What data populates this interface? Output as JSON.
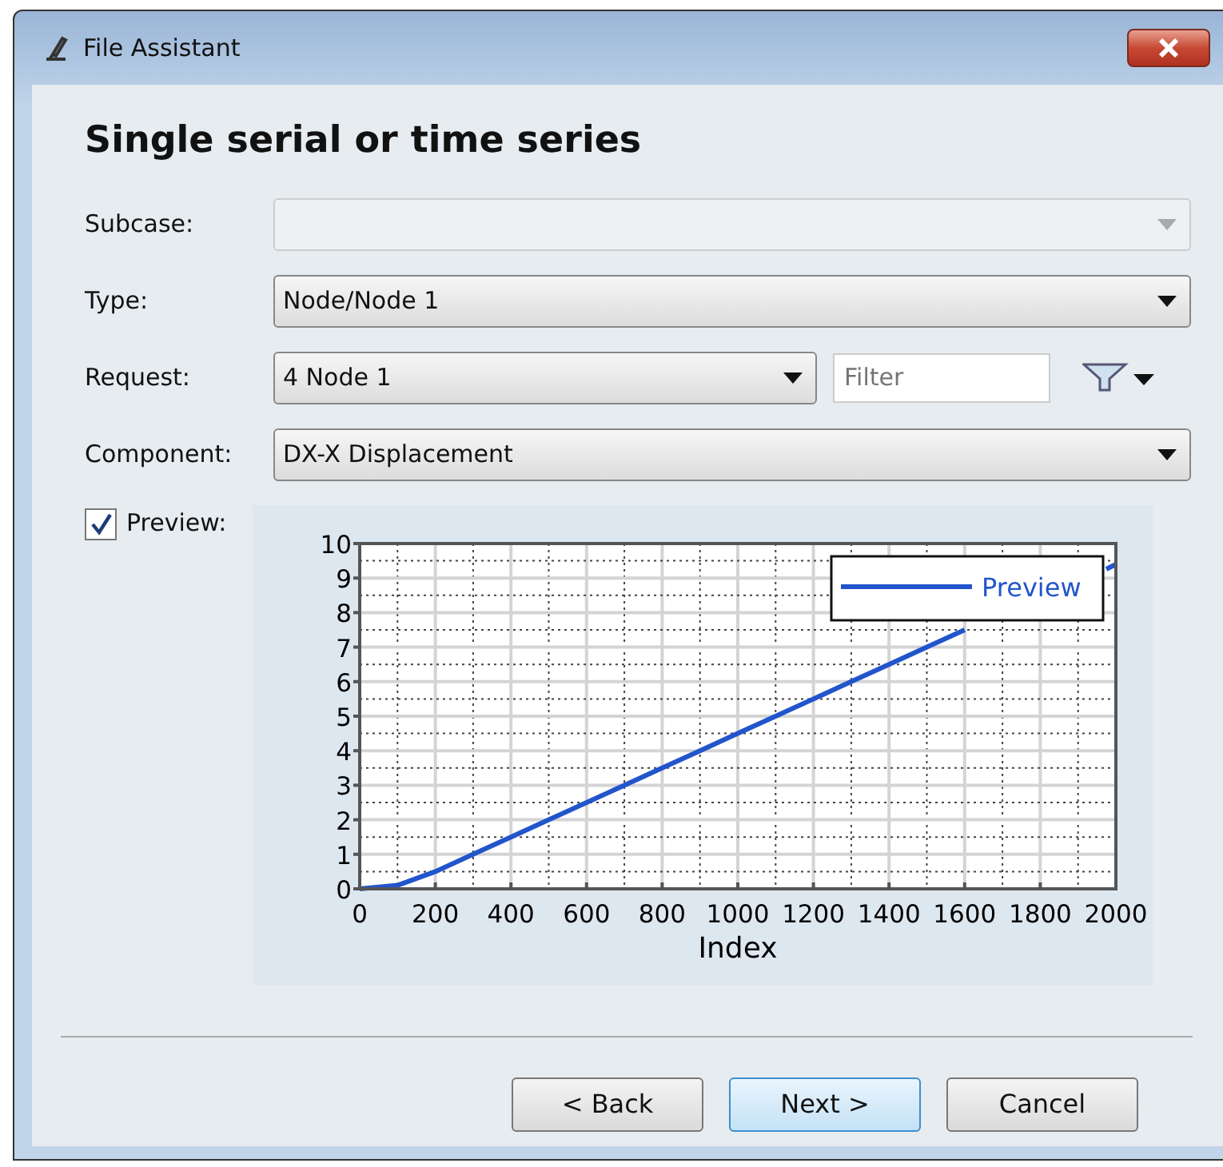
{
  "window": {
    "title": "File Assistant"
  },
  "heading": "Single serial or time series",
  "fields": [
    {
      "kind": "select",
      "label": "Subcase:",
      "disabled": true
    },
    {
      "kind": "select",
      "label": "Type:",
      "value": "Node/Node 1",
      "disabled": false
    },
    {
      "kind": "select_filter",
      "label": "Request:",
      "value": "4 Node 1",
      "disabled": false,
      "filter_placeholder": "Filter"
    },
    {
      "kind": "select",
      "label": "Component:",
      "value": "DX-X Displacement",
      "disabled": false
    }
  ],
  "preview": {
    "label": "Preview:",
    "checked": true,
    "chart_data": {
      "type": "line",
      "grid": true,
      "xlabel": "Index",
      "xlim": [
        0,
        2000
      ],
      "ylim": [
        0,
        10
      ],
      "xticks": [
        0,
        200,
        400,
        600,
        800,
        1000,
        1200,
        1400,
        1600,
        1800,
        2000
      ],
      "yticks": [
        0,
        1,
        2,
        3,
        4,
        5,
        6,
        7,
        8,
        9,
        10
      ],
      "x": [
        0,
        100,
        200,
        300,
        400,
        500,
        600,
        700,
        800,
        900,
        1000,
        1100,
        1200,
        1300,
        1400,
        1500,
        1600,
        1700,
        1800,
        1900,
        2000
      ],
      "series": [
        {
          "name": "Preview",
          "color": "#2255cc",
          "values": [
            0,
            0.1,
            0.5,
            1.0,
            1.5,
            2.0,
            2.5,
            3.0,
            3.5,
            4.0,
            4.5,
            5.0,
            5.5,
            6.0,
            6.5,
            7.0,
            7.5,
            null,
            null,
            null,
            9.4
          ]
        }
      ]
    }
  },
  "buttons": [
    {
      "label": "< Back",
      "default": false
    },
    {
      "label": "Next >",
      "default": true
    },
    {
      "label": "Cancel",
      "default": false
    }
  ]
}
